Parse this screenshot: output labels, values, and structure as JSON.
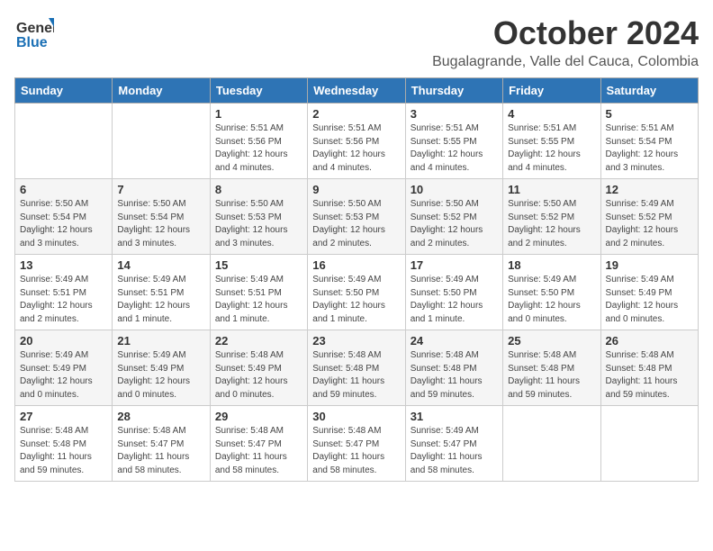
{
  "header": {
    "logo_general": "General",
    "logo_blue": "Blue",
    "month_title": "October 2024",
    "subtitle": "Bugalagrande, Valle del Cauca, Colombia"
  },
  "days_of_week": [
    "Sunday",
    "Monday",
    "Tuesday",
    "Wednesday",
    "Thursday",
    "Friday",
    "Saturday"
  ],
  "weeks": [
    [
      {
        "day": "",
        "info": ""
      },
      {
        "day": "",
        "info": ""
      },
      {
        "day": "1",
        "info": "Sunrise: 5:51 AM\nSunset: 5:56 PM\nDaylight: 12 hours and 4 minutes."
      },
      {
        "day": "2",
        "info": "Sunrise: 5:51 AM\nSunset: 5:56 PM\nDaylight: 12 hours and 4 minutes."
      },
      {
        "day": "3",
        "info": "Sunrise: 5:51 AM\nSunset: 5:55 PM\nDaylight: 12 hours and 4 minutes."
      },
      {
        "day": "4",
        "info": "Sunrise: 5:51 AM\nSunset: 5:55 PM\nDaylight: 12 hours and 4 minutes."
      },
      {
        "day": "5",
        "info": "Sunrise: 5:51 AM\nSunset: 5:54 PM\nDaylight: 12 hours and 3 minutes."
      }
    ],
    [
      {
        "day": "6",
        "info": "Sunrise: 5:50 AM\nSunset: 5:54 PM\nDaylight: 12 hours and 3 minutes."
      },
      {
        "day": "7",
        "info": "Sunrise: 5:50 AM\nSunset: 5:54 PM\nDaylight: 12 hours and 3 minutes."
      },
      {
        "day": "8",
        "info": "Sunrise: 5:50 AM\nSunset: 5:53 PM\nDaylight: 12 hours and 3 minutes."
      },
      {
        "day": "9",
        "info": "Sunrise: 5:50 AM\nSunset: 5:53 PM\nDaylight: 12 hours and 2 minutes."
      },
      {
        "day": "10",
        "info": "Sunrise: 5:50 AM\nSunset: 5:52 PM\nDaylight: 12 hours and 2 minutes."
      },
      {
        "day": "11",
        "info": "Sunrise: 5:50 AM\nSunset: 5:52 PM\nDaylight: 12 hours and 2 minutes."
      },
      {
        "day": "12",
        "info": "Sunrise: 5:49 AM\nSunset: 5:52 PM\nDaylight: 12 hours and 2 minutes."
      }
    ],
    [
      {
        "day": "13",
        "info": "Sunrise: 5:49 AM\nSunset: 5:51 PM\nDaylight: 12 hours and 2 minutes."
      },
      {
        "day": "14",
        "info": "Sunrise: 5:49 AM\nSunset: 5:51 PM\nDaylight: 12 hours and 1 minute."
      },
      {
        "day": "15",
        "info": "Sunrise: 5:49 AM\nSunset: 5:51 PM\nDaylight: 12 hours and 1 minute."
      },
      {
        "day": "16",
        "info": "Sunrise: 5:49 AM\nSunset: 5:50 PM\nDaylight: 12 hours and 1 minute."
      },
      {
        "day": "17",
        "info": "Sunrise: 5:49 AM\nSunset: 5:50 PM\nDaylight: 12 hours and 1 minute."
      },
      {
        "day": "18",
        "info": "Sunrise: 5:49 AM\nSunset: 5:50 PM\nDaylight: 12 hours and 0 minutes."
      },
      {
        "day": "19",
        "info": "Sunrise: 5:49 AM\nSunset: 5:49 PM\nDaylight: 12 hours and 0 minutes."
      }
    ],
    [
      {
        "day": "20",
        "info": "Sunrise: 5:49 AM\nSunset: 5:49 PM\nDaylight: 12 hours and 0 minutes."
      },
      {
        "day": "21",
        "info": "Sunrise: 5:49 AM\nSunset: 5:49 PM\nDaylight: 12 hours and 0 minutes."
      },
      {
        "day": "22",
        "info": "Sunrise: 5:48 AM\nSunset: 5:49 PM\nDaylight: 12 hours and 0 minutes."
      },
      {
        "day": "23",
        "info": "Sunrise: 5:48 AM\nSunset: 5:48 PM\nDaylight: 11 hours and 59 minutes."
      },
      {
        "day": "24",
        "info": "Sunrise: 5:48 AM\nSunset: 5:48 PM\nDaylight: 11 hours and 59 minutes."
      },
      {
        "day": "25",
        "info": "Sunrise: 5:48 AM\nSunset: 5:48 PM\nDaylight: 11 hours and 59 minutes."
      },
      {
        "day": "26",
        "info": "Sunrise: 5:48 AM\nSunset: 5:48 PM\nDaylight: 11 hours and 59 minutes."
      }
    ],
    [
      {
        "day": "27",
        "info": "Sunrise: 5:48 AM\nSunset: 5:48 PM\nDaylight: 11 hours and 59 minutes."
      },
      {
        "day": "28",
        "info": "Sunrise: 5:48 AM\nSunset: 5:47 PM\nDaylight: 11 hours and 58 minutes."
      },
      {
        "day": "29",
        "info": "Sunrise: 5:48 AM\nSunset: 5:47 PM\nDaylight: 11 hours and 58 minutes."
      },
      {
        "day": "30",
        "info": "Sunrise: 5:48 AM\nSunset: 5:47 PM\nDaylight: 11 hours and 58 minutes."
      },
      {
        "day": "31",
        "info": "Sunrise: 5:49 AM\nSunset: 5:47 PM\nDaylight: 11 hours and 58 minutes."
      },
      {
        "day": "",
        "info": ""
      },
      {
        "day": "",
        "info": ""
      }
    ]
  ]
}
